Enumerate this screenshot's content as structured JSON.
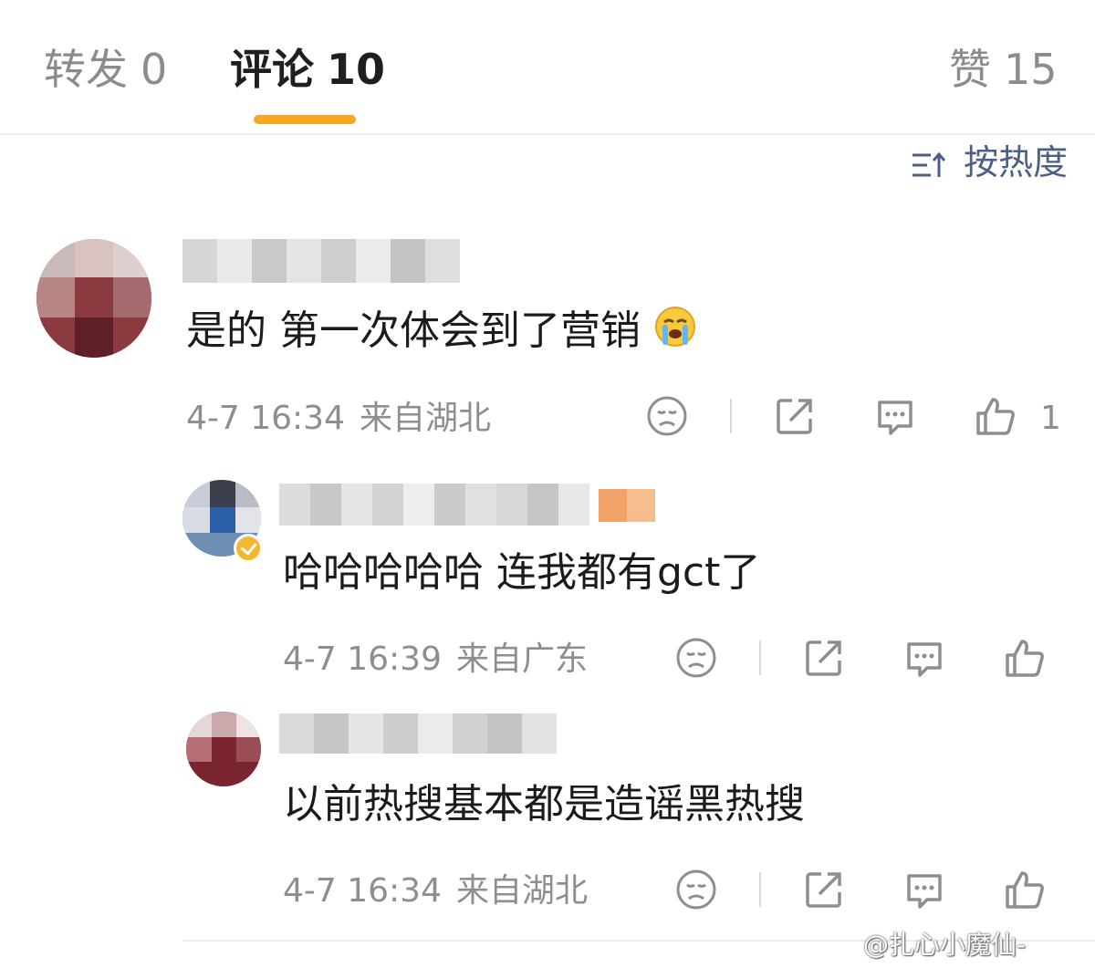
{
  "tabs": {
    "repost_label": "转发",
    "repost_count": "0",
    "comments_label": "评论",
    "comments_count": "10",
    "likes_label": "赞",
    "likes_count": "15",
    "accent_color": "#f6a623"
  },
  "sort": {
    "label": "按热度",
    "icon": "sort-icon"
  },
  "comments": [
    {
      "text": "是的 第一次体会到了营销",
      "emoji": "crying-face-emoji",
      "time": "4-7 16:34",
      "location": "来自湖北",
      "like_count": "1"
    },
    {
      "text": "哈哈哈哈哈 连我都有gct了",
      "time": "4-7 16:39",
      "location": "来自广东",
      "badge": "verified-badge"
    },
    {
      "text": "以前热搜基本都是造谣黑热搜",
      "time": "4-7 16:34",
      "location": "来自湖北"
    }
  ],
  "watermark": "@扎心小魔仙-"
}
